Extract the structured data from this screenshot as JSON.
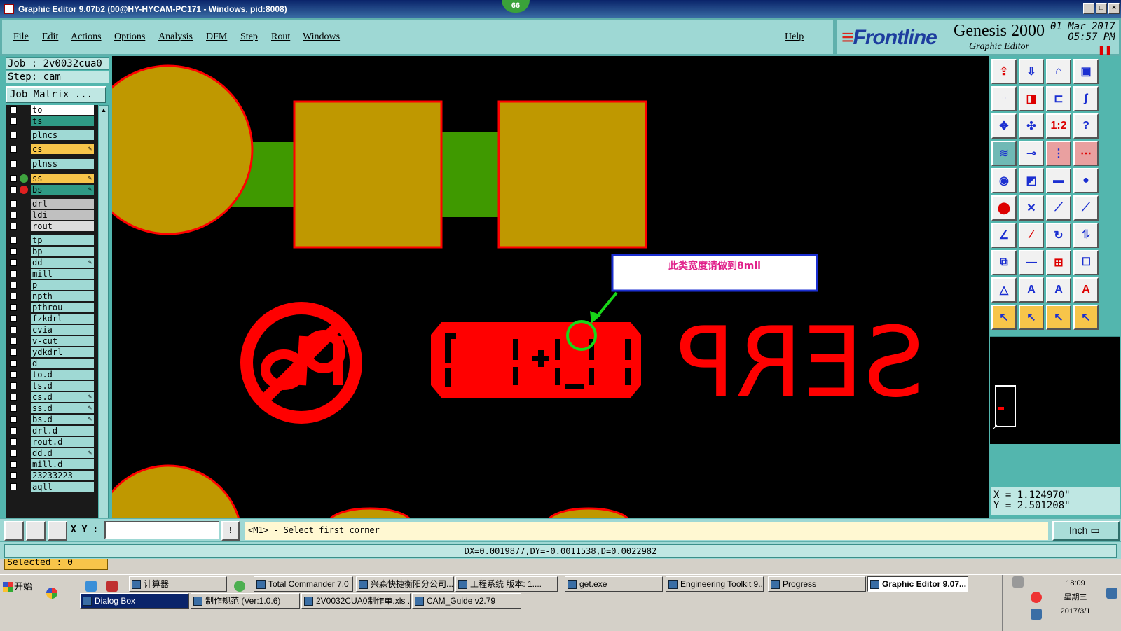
{
  "window": {
    "title": "Graphic Editor 9.07b2 (00@HY-HYCAM-PC171 - Windows, pid:8008)",
    "badge": "66"
  },
  "menu": {
    "items": [
      "File",
      "Edit",
      "Actions",
      "Options",
      "Analysis",
      "DFM",
      "Step",
      "Rout",
      "Windows"
    ],
    "help": "Help"
  },
  "brand": {
    "logo_prefix": "≡",
    "logo": "Frontline",
    "product": "Genesis 2000",
    "subtitle": "Graphic Editor",
    "date": "01 Mar 2017",
    "time": "05:57 PM",
    "pause_icon": "pause-icon"
  },
  "job": {
    "job_line": "Job : 2v0032cua0",
    "step_line": "Step: cam",
    "matrix_button": "Job Matrix ..."
  },
  "layers": [
    {
      "name": "to",
      "bg": "#ffffff",
      "dot": "",
      "mark": ""
    },
    {
      "name": "ts",
      "bg": "#2f9a85",
      "dot": "",
      "mark": ""
    },
    {
      "name": "plncs",
      "bg": "#9fd9d4",
      "dot": "",
      "mark": ""
    },
    {
      "name": "cs",
      "bg": "#f7c54a",
      "dot": "",
      "mark": "✎"
    },
    {
      "name": "plnss",
      "bg": "#9fd9d4",
      "dot": "",
      "mark": ""
    },
    {
      "name": "ss",
      "bg": "#f7c54a",
      "dot": "#3fa33f",
      "mark": "✎"
    },
    {
      "name": "bs",
      "bg": "#2f9a85",
      "dot": "#e02020",
      "mark": "✎"
    },
    {
      "name": "drl",
      "bg": "#c0c0c0",
      "dot": "",
      "mark": ""
    },
    {
      "name": "ldi",
      "bg": "#c0c0c0",
      "dot": "",
      "mark": ""
    },
    {
      "name": "rout",
      "bg": "#dcdcdc",
      "dot": "",
      "mark": ""
    },
    {
      "name": "tp",
      "bg": "#9fd9d4",
      "dot": "",
      "mark": ""
    },
    {
      "name": "bp",
      "bg": "#9fd9d4",
      "dot": "",
      "mark": ""
    },
    {
      "name": "dd",
      "bg": "#9fd9d4",
      "dot": "",
      "mark": "✎"
    },
    {
      "name": "mill",
      "bg": "#9fd9d4",
      "dot": "",
      "mark": ""
    },
    {
      "name": "p",
      "bg": "#9fd9d4",
      "dot": "",
      "mark": ""
    },
    {
      "name": "npth",
      "bg": "#9fd9d4",
      "dot": "",
      "mark": ""
    },
    {
      "name": "pthrou",
      "bg": "#9fd9d4",
      "dot": "",
      "mark": ""
    },
    {
      "name": "fzkdrl",
      "bg": "#9fd9d4",
      "dot": "",
      "mark": ""
    },
    {
      "name": "cvia",
      "bg": "#9fd9d4",
      "dot": "",
      "mark": ""
    },
    {
      "name": "v-cut",
      "bg": "#9fd9d4",
      "dot": "",
      "mark": ""
    },
    {
      "name": "ydkdrl",
      "bg": "#9fd9d4",
      "dot": "",
      "mark": ""
    },
    {
      "name": "d",
      "bg": "#9fd9d4",
      "dot": "",
      "mark": ""
    },
    {
      "name": "to.d",
      "bg": "#9fd9d4",
      "dot": "",
      "mark": ""
    },
    {
      "name": "ts.d",
      "bg": "#9fd9d4",
      "dot": "",
      "mark": ""
    },
    {
      "name": "cs.d",
      "bg": "#9fd9d4",
      "dot": "",
      "mark": "✎"
    },
    {
      "name": "ss.d",
      "bg": "#9fd9d4",
      "dot": "",
      "mark": "✎"
    },
    {
      "name": "bs.d",
      "bg": "#9fd9d4",
      "dot": "",
      "mark": "✎"
    },
    {
      "name": "drl.d",
      "bg": "#9fd9d4",
      "dot": "",
      "mark": ""
    },
    {
      "name": "rout.d",
      "bg": "#9fd9d4",
      "dot": "",
      "mark": ""
    },
    {
      "name": "dd.d",
      "bg": "#9fd9d4",
      "dot": "",
      "mark": "✎"
    },
    {
      "name": "mill.d",
      "bg": "#9fd9d4",
      "dot": "",
      "mark": ""
    },
    {
      "name": "23233223",
      "bg": "#9fd9d4",
      "dot": "",
      "mark": ""
    },
    {
      "name": "aqll",
      "bg": "#9fd9d4",
      "dot": "",
      "mark": ""
    }
  ],
  "selected": "Selected : 0",
  "canvas": {
    "annotation": "此类宽度请做到8mil",
    "silk_text": "SERP",
    "copper_color": "#bf9800",
    "trace_color": "#3f9900",
    "mask_color": "#ff0000",
    "marker_color": "#18d818"
  },
  "coords": {
    "x": "X = 1.124970\"",
    "y": "Y = 2.501208\""
  },
  "command": {
    "xy_label": "X Y :",
    "input_value": "",
    "hint": "<M1> - Select first corner",
    "unit": "Inch"
  },
  "status": "DX=0.0019877,DY=-0.0011538,D=0.0022982",
  "taskbar": {
    "start": "开始",
    "row1": [
      "计算器",
      "Total Commander 7.0 ...",
      "兴森快捷衡阳分公司...",
      "工程系统  版本: 1....",
      "get.exe",
      "Engineering Toolkit 9....",
      "Progress",
      "Graphic Editor 9.07..."
    ],
    "row2": [
      "Dialog Box",
      "制作规范 (Ver:1.0.6)",
      "2V0032CUA0制作单.xls ...",
      "CAM_Guide v2.79"
    ],
    "clock": "18:09",
    "weekday": "星期三",
    "date": "2017/3/1"
  }
}
